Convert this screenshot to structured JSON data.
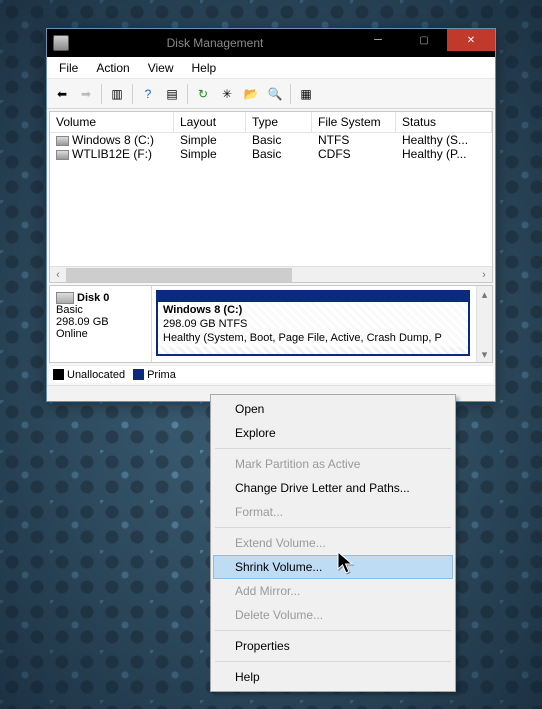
{
  "window": {
    "title": "Disk Management"
  },
  "menubar": {
    "file": "File",
    "action": "Action",
    "view": "View",
    "help": "Help"
  },
  "columns": {
    "volume": "Volume",
    "layout": "Layout",
    "type": "Type",
    "fs": "File System",
    "status": "Status"
  },
  "volumes": [
    {
      "name": "Windows 8 (C:)",
      "layout": "Simple",
      "type": "Basic",
      "fs": "NTFS",
      "status": "Healthy (S..."
    },
    {
      "name": "WTLIB12E (F:)",
      "layout": "Simple",
      "type": "Basic",
      "fs": "CDFS",
      "status": "Healthy (P..."
    }
  ],
  "disk": {
    "label": "Disk 0",
    "bus": "Basic",
    "size": "298.09 GB",
    "state": "Online",
    "partition": {
      "name": "Windows 8  (C:)",
      "desc": "298.09 GB NTFS",
      "health": "Healthy (System, Boot, Page File, Active, Crash Dump, P"
    }
  },
  "legend": {
    "unallocated": "Unallocated",
    "primary": "Prima"
  },
  "context": {
    "open": "Open",
    "explore": "Explore",
    "mark_active": "Mark Partition as Active",
    "change_letter": "Change Drive Letter and Paths...",
    "format": "Format...",
    "extend": "Extend Volume...",
    "shrink": "Shrink Volume...",
    "add_mirror": "Add Mirror...",
    "delete": "Delete Volume...",
    "properties": "Properties",
    "help": "Help"
  }
}
